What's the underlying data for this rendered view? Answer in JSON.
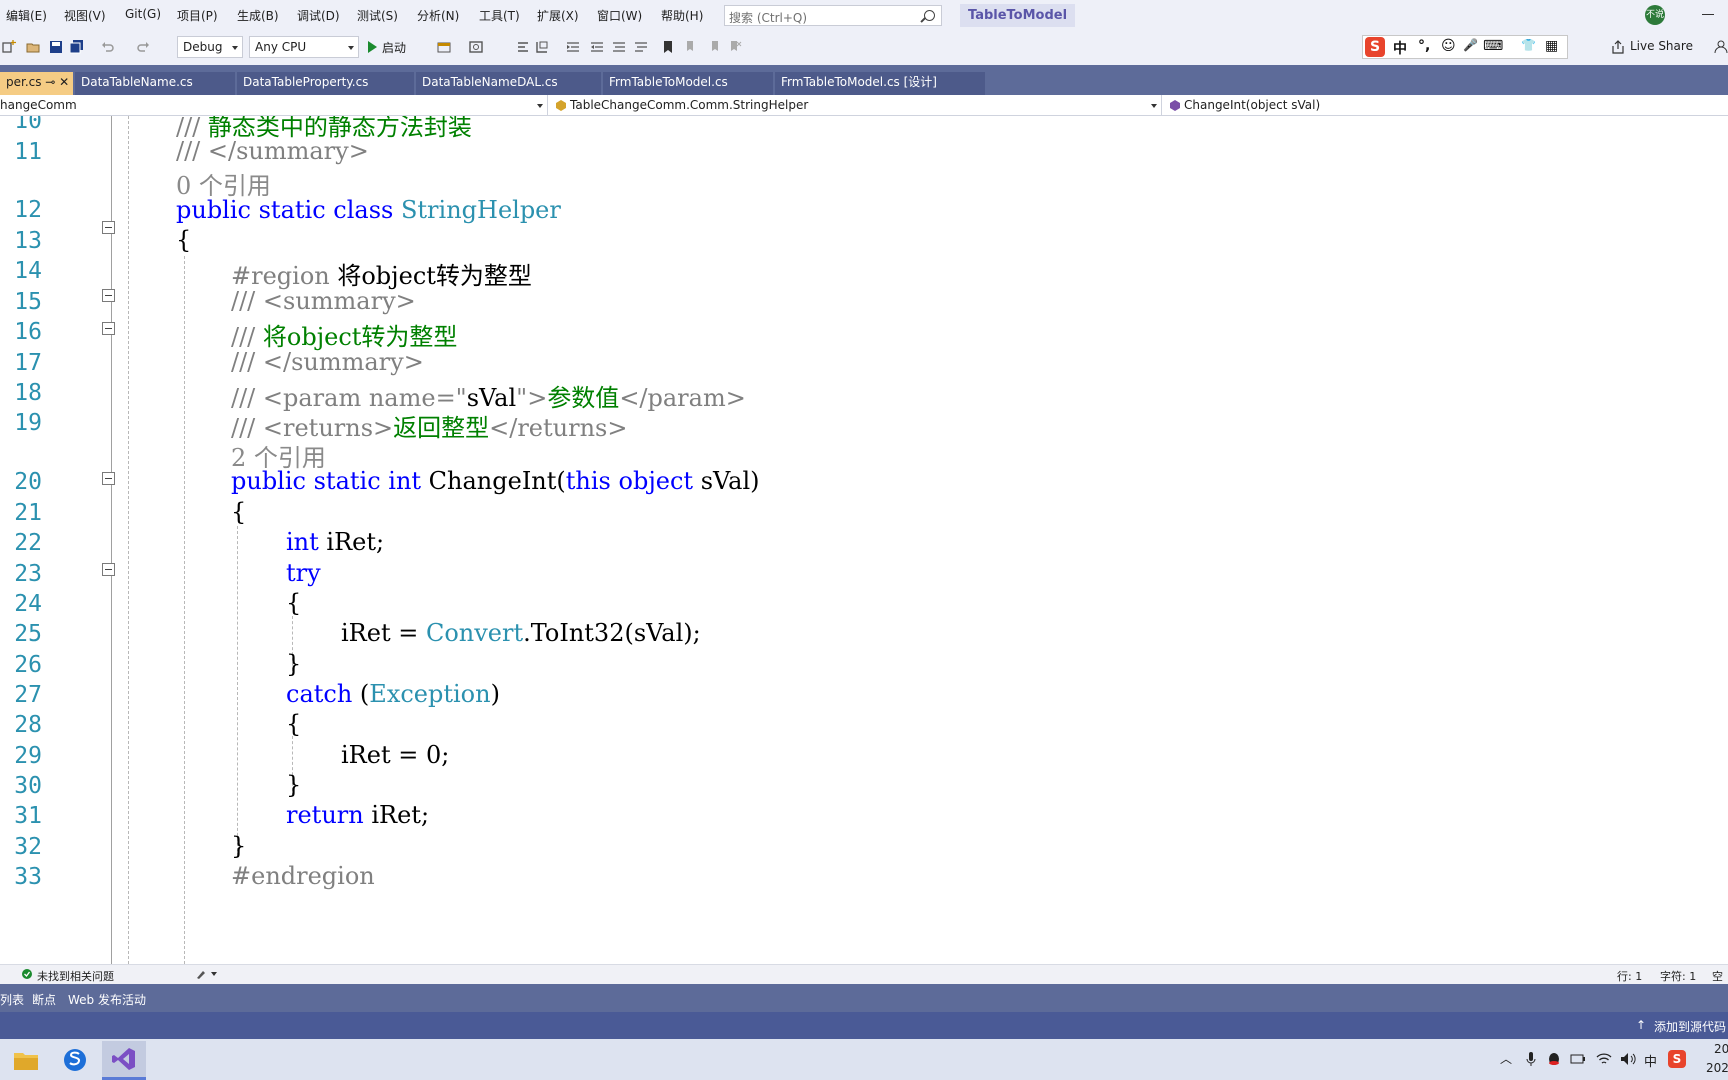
{
  "menu": {
    "items": [
      "编辑(E)",
      "视图(V)",
      "Git(G)",
      "项目(P)",
      "生成(B)",
      "调试(D)",
      "测试(S)",
      "分析(N)",
      "工具(T)",
      "扩展(X)",
      "窗口(W)",
      "帮助(H)"
    ],
    "search_placeholder": "搜索 (Ctrl+Q)",
    "solution_name": "TableToModel",
    "avatar_text": "不说"
  },
  "toolbar": {
    "configuration": "Debug",
    "platform": "Any CPU",
    "start_label": "启动",
    "live_share": "Live Share",
    "ime_glyphs": [
      "中",
      "°,",
      "☺",
      "🎤",
      "⌨",
      "👕",
      "▦"
    ]
  },
  "tabs": [
    {
      "label": "per.cs  ⊸  ✕",
      "active": true
    },
    {
      "label": "DataTableName.cs",
      "active": false
    },
    {
      "label": "DataTableProperty.cs",
      "active": false
    },
    {
      "label": "DataTableNameDAL.cs",
      "active": false
    },
    {
      "label": "FrmTableToModel.cs",
      "active": false
    },
    {
      "label": "FrmTableToModel.cs [设计]",
      "active": false
    }
  ],
  "navbar": {
    "project": "hangeComm",
    "type": "TableChangeComm.Comm.StringHelper",
    "member": "ChangeInt(object sVal)"
  },
  "code": {
    "line_numbers": [
      "10",
      "11",
      "12",
      "13",
      "14",
      "15",
      "16",
      "17",
      "18",
      "19",
      "20",
      "21",
      "22",
      "23",
      "24",
      "25",
      "26",
      "27",
      "28",
      "29",
      "30",
      "31",
      "32",
      "33"
    ],
    "l10_prefix": "/// ",
    "l10_text": "静态类中的静态方法封装",
    "l11": "/// </summary>",
    "ref0": "0 个引用",
    "l12_kw": "public static class ",
    "l12_type": "StringHelper",
    "l13": "{",
    "l14_kw": "#region ",
    "l14_text": "将object转为整型",
    "l15": "/// <summary>",
    "l16_prefix": "/// ",
    "l16_text": "将object转为整型",
    "l17": "/// </summary>",
    "l18_a": "/// <param name=\"",
    "l18_b": "sVal",
    "l18_c": "\">",
    "l18_d": "参数值",
    "l18_e": "</param>",
    "l19_a": "/// <returns>",
    "l19_b": "返回整型",
    "l19_c": "</returns>",
    "ref2": "2 个引用",
    "l20_kw": "public static int ",
    "l20_name": "ChangeInt(",
    "l20_kw2": "this object ",
    "l20_rest": "sVal)",
    "l21": "{",
    "l22_kw": "int ",
    "l22_rest": "iRet;",
    "l23": "try",
    "l24": "{",
    "l25_a": "iRet = ",
    "l25_type": "Convert",
    "l25_b": ".ToInt32(sVal);",
    "l26": "}",
    "l27_kw": "catch ",
    "l27_a": "(",
    "l27_type": "Exception",
    "l27_b": ")",
    "l28": "{",
    "l29": "iRet = 0;",
    "l30": "}",
    "l31_kw": "return ",
    "l31_rest": "iRet;",
    "l32": "}",
    "l33": "#endregion"
  },
  "status": {
    "issues": "未找到相关问题",
    "line": "行: 1",
    "char": "字符: 1",
    "spaces": "空格"
  },
  "tool_tabs": [
    "列表",
    "断点",
    "Web 发布活动"
  ],
  "source_control": "添加到源代码",
  "tray": {
    "time": "20",
    "date": "202",
    "lang": "中"
  },
  "colors": {
    "accent_tab": "#5d6b99",
    "active_tab": "#f5cc84",
    "status_bar": "#4a5a96"
  }
}
